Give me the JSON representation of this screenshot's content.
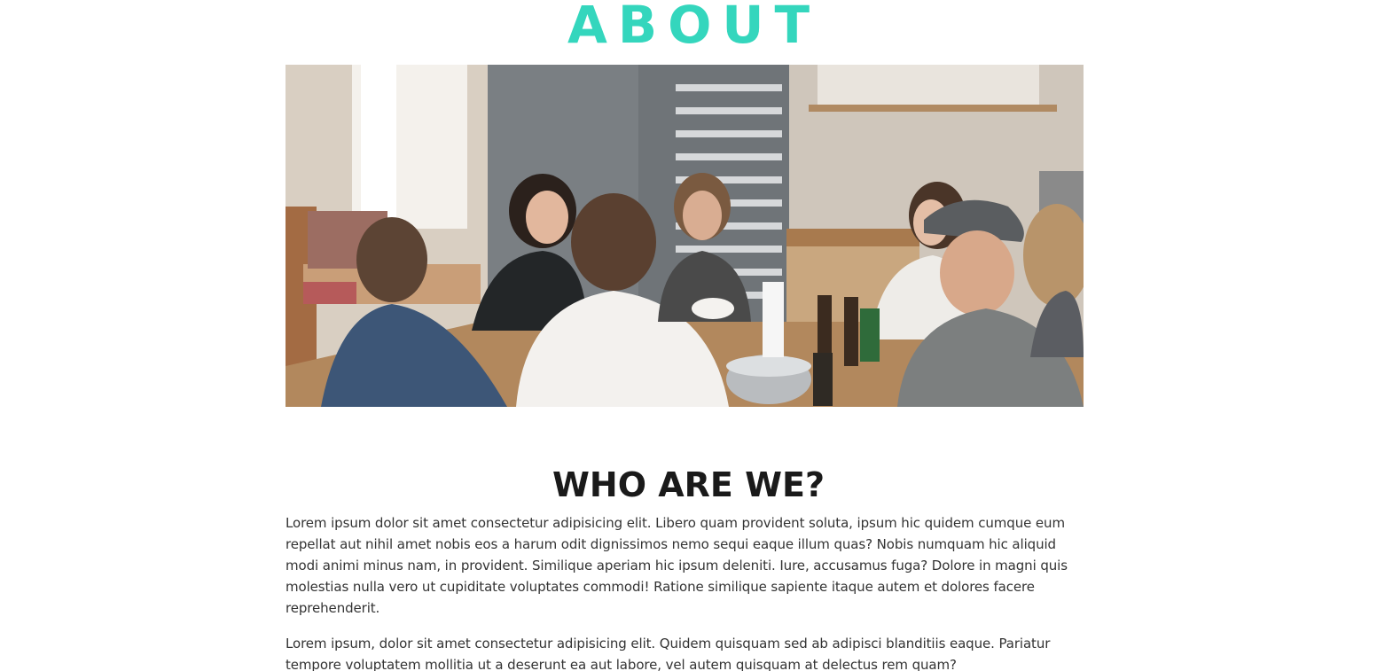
{
  "page": {
    "heading": "ABOUT",
    "accent_color": "#34d6bd"
  },
  "hero_image": {
    "icon": "photo-group-meeting"
  },
  "section": {
    "title": "WHO ARE WE?",
    "paragraphs": [
      "Lorem ipsum dolor sit amet consectetur adipisicing elit. Libero quam provident soluta, ipsum hic quidem cumque eum repellat aut nihil amet nobis eos a harum odit dignissimos nemo sequi eaque illum quas? Nobis numquam hic aliquid modi animi minus nam, in provident. Similique aperiam hic ipsum deleniti. Iure, accusamus fuga? Dolore in magni quis molestias nulla vero ut cupiditate voluptates commodi! Ratione similique sapiente itaque autem et dolores facere reprehenderit.",
      "Lorem ipsum, dolor sit amet consectetur adipisicing elit. Quidem quisquam sed ab adipisci blanditiis eaque. Pariatur tempore voluptatem mollitia ut a deserunt ea aut labore, vel autem quisquam at delectus rem quam?"
    ]
  }
}
